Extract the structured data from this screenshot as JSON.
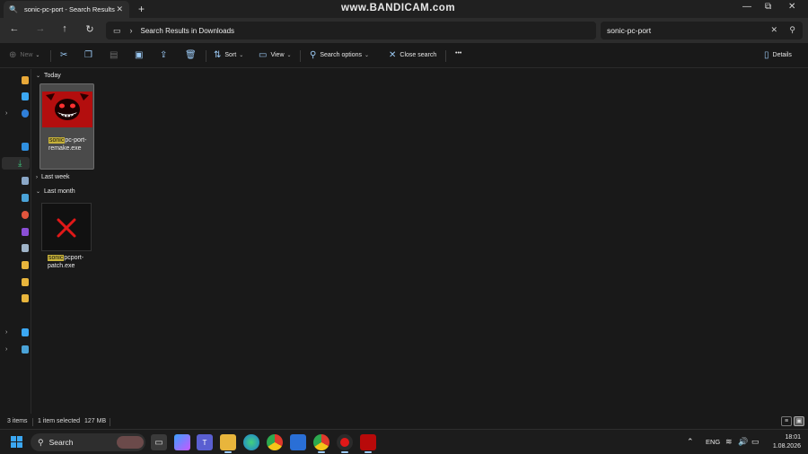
{
  "window": {
    "tab_title": "sonic-pc-port - Search Results",
    "tab_icon": "search-icon",
    "new_tab_label": "+",
    "watermark": "www.BANDICAM.com",
    "controls": [
      "—",
      "⧉",
      "✕"
    ]
  },
  "address": {
    "path": "Search Results in Downloads",
    "search_value": "sonic-pc-port"
  },
  "commands": {
    "new": "New",
    "sort": "Sort",
    "view": "View",
    "search_options": "Search options",
    "close_search": "Close search",
    "more": "•••",
    "details": "Details"
  },
  "groups": [
    {
      "label": "Today",
      "expanded": true,
      "files": [
        {
          "highlight": "sonic",
          "rest1": "pc-port-",
          "rest2": "remake.exe",
          "selected": true,
          "thumbnail": "red-sonic-exe-face"
        }
      ]
    },
    {
      "label": "Last week",
      "expanded": false,
      "files": []
    },
    {
      "label": "Last month",
      "expanded": true,
      "files": [
        {
          "highlight": "sonic",
          "rest1": "pcport-",
          "rest2": "patch.exe",
          "selected": false,
          "thumbnail": "red-x-mark"
        }
      ]
    }
  ],
  "status": {
    "item_count": "3 items",
    "selection": "1 item selected",
    "size": "127 MB"
  },
  "taskbar": {
    "search_label": "Search",
    "language": "ENG",
    "time": "18:01",
    "date": "1.08.2026"
  },
  "colors": {
    "accent": "#9ccaf5",
    "search_highlight": "#c7b23a",
    "windows_blue": "#3ba7f2"
  }
}
